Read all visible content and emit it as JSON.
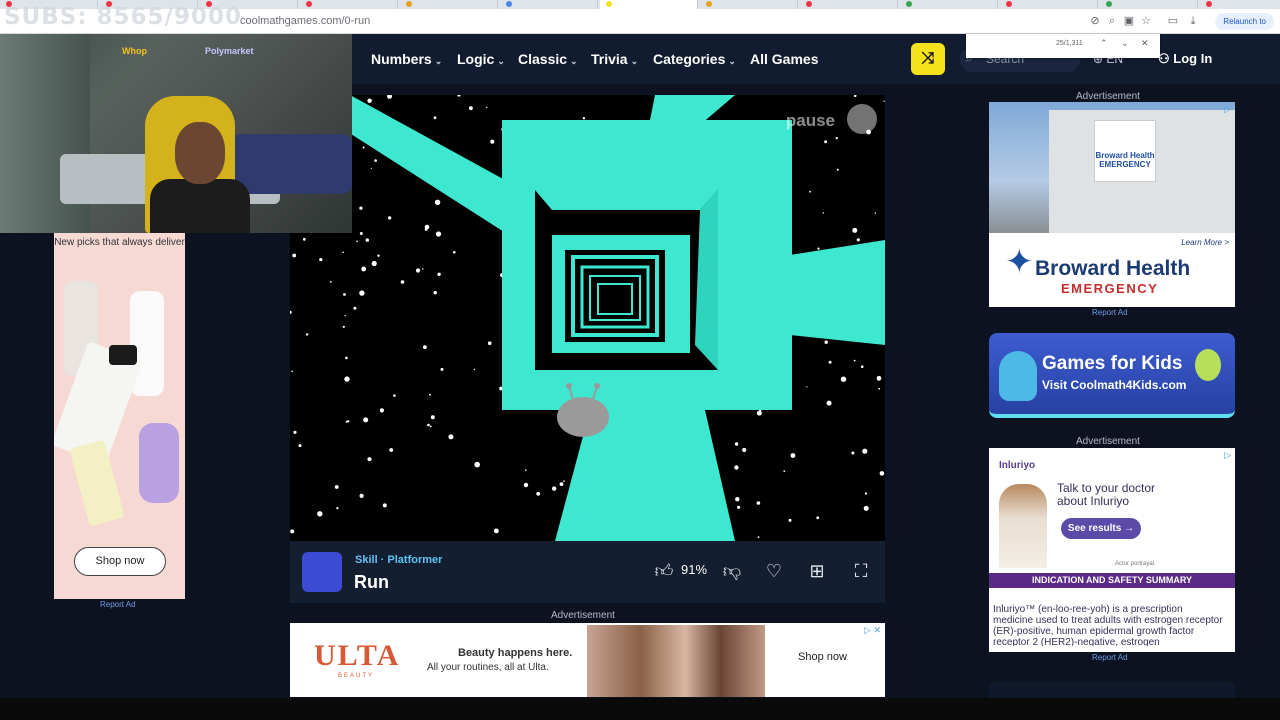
{
  "overlay": {
    "subs": "SUBS: 8565/9000"
  },
  "browser": {
    "url": "coolmathgames.com/0-run",
    "relaunch_label": "Relaunch to",
    "find_count": "25/1,311"
  },
  "nav": {
    "items": [
      {
        "label": "Numbers",
        "chevron": true
      },
      {
        "label": "Logic",
        "chevron": true
      },
      {
        "label": "Classic",
        "chevron": true
      },
      {
        "label": "Trivia",
        "chevron": true
      },
      {
        "label": "Categories",
        "chevron": true
      },
      {
        "label": "All Games",
        "chevron": false
      }
    ],
    "search_placeholder": "Search",
    "lang": "EN",
    "login": "Log In"
  },
  "webcam": {
    "badge1": "Whop",
    "badge2": "Polymarket"
  },
  "game": {
    "pause_label": "pause",
    "category": "Skill · Platformer",
    "title": "Run",
    "rating": "91%"
  },
  "ads": {
    "label": "Advertisement",
    "report": "Report Ad",
    "ulta": {
      "logo": "ULTA",
      "logo_sub": "BEAUTY",
      "headline": "Beauty happens here.",
      "text": "All your routines, all at Ulta.",
      "shop": "Shop now"
    },
    "left": {
      "headline": "New picks that always deliver",
      "shop": "Shop now"
    },
    "broward": {
      "learn_more": "Learn More >",
      "name": "Broward Health",
      "sub": "EMERGENCY",
      "sign": "Broward Health EMERGENCY"
    },
    "kids": {
      "title": "Games for Kids",
      "sub": "Visit Coolmath4Kids.com"
    },
    "inluriyo": {
      "logo": "Inluriyo",
      "talk": "Talk to your doctor about Inluriyo",
      "button": "See results →",
      "portrayal": "Actor portrayal.",
      "bar": "INDICATION AND SAFETY SUMMARY",
      "body": "Inluriyo™ (en-loo-ree-yoh) is a prescription medicine used to treat adults with estrogen receptor (ER)-positive, human epidermal growth factor receptor 2 (HER2)-negative, estrogen"
    }
  },
  "colors": {
    "accent": "#f6e21b",
    "tunnel": "#3ee7cf",
    "nav_bg": "#111c30"
  }
}
